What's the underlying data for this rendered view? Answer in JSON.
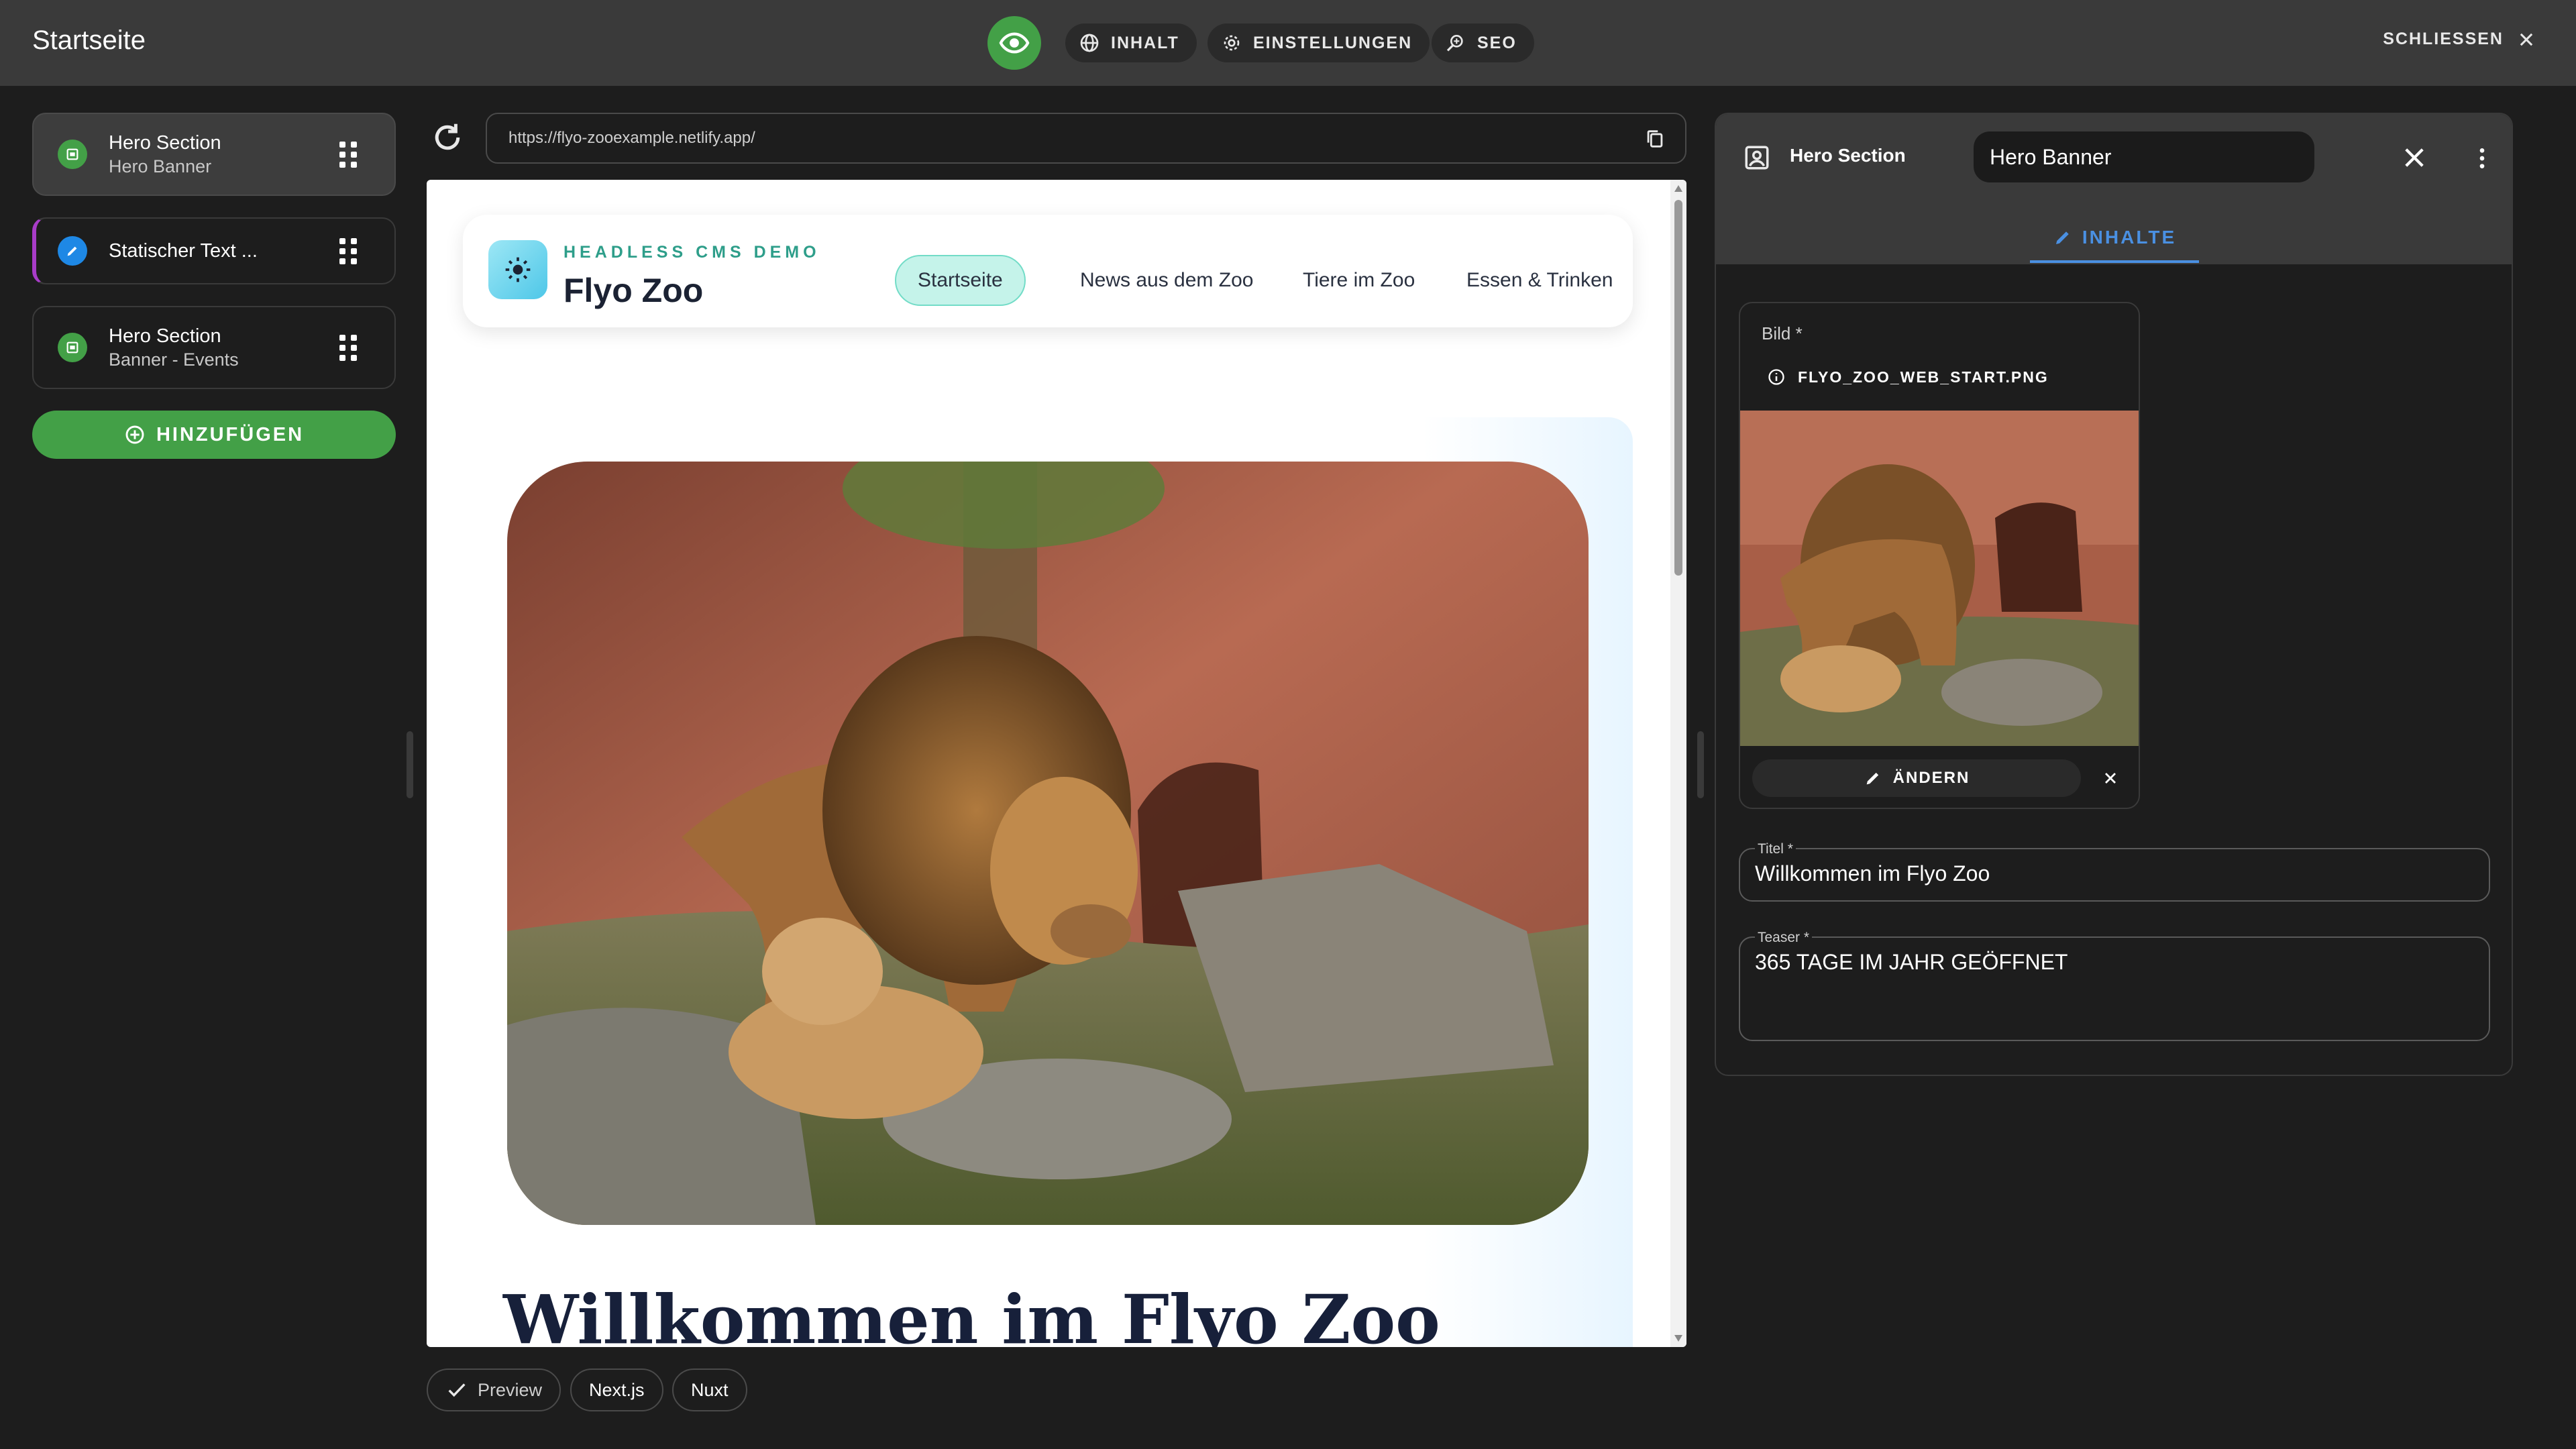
{
  "topbar": {
    "title": "Startseite",
    "tabs": [
      {
        "label": "INHALT",
        "icon": "globe-icon"
      },
      {
        "label": "EINSTELLUNGEN",
        "icon": "gear-icon"
      },
      {
        "label": "SEO",
        "icon": "seo-search-icon"
      }
    ],
    "close_label": "SCHLIESSEN"
  },
  "sidebar": {
    "items": [
      {
        "title": "Hero Section",
        "subtitle": "Hero Banner",
        "icon": "section-icon",
        "color": "#43a047"
      },
      {
        "title": "Statischer Text ...",
        "subtitle": "",
        "icon": "pencil-icon",
        "color": "#1e88e5"
      },
      {
        "title": "Hero Section",
        "subtitle": "Banner - Events",
        "icon": "section-icon",
        "color": "#43a047"
      }
    ],
    "add_label": "HINZUFÜGEN"
  },
  "preview": {
    "url": "https://flyo-zooexample.netlify.app/",
    "site": {
      "kicker": "HEADLESS CMS DEMO",
      "name": "Flyo Zoo",
      "nav": [
        "Startseite",
        "News aus dem Zoo",
        "Tiere im Zoo",
        "Essen & Trinken"
      ],
      "active_nav": "Startseite",
      "hero_title": "Willkommen im Flyo Zoo"
    },
    "frameworks": [
      "Preview",
      "Next.js",
      "Nuxt"
    ]
  },
  "panel": {
    "title": "Hero Section",
    "name_value": "Hero Banner",
    "tab": "INHALTE",
    "image": {
      "label": "Bild *",
      "filename": "FLYO_ZOO_WEB_START.PNG",
      "change_label": "ÄNDERN"
    },
    "fields": [
      {
        "label": "Titel *",
        "value": "Willkommen im Flyo Zoo"
      },
      {
        "label": "Teaser *",
        "value": "365 TAGE IM JAHR GEÖFFNET"
      }
    ]
  },
  "colors": {
    "accent_green": "#43a047",
    "accent_blue": "#4a90e2",
    "background": "#1d1d1d",
    "topbar": "#3a3a3a"
  }
}
